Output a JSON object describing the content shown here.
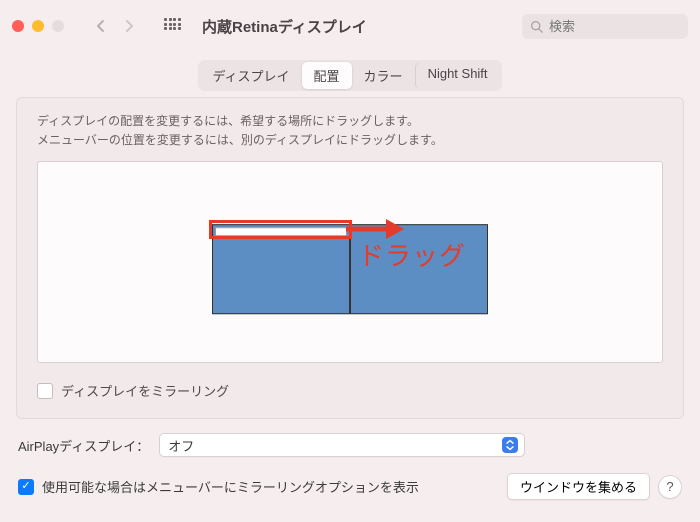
{
  "header": {
    "title": "内蔵Retinaディスプレイ",
    "search_placeholder": "検索"
  },
  "tabs": {
    "display": "ディスプレイ",
    "arrangement": "配置",
    "color": "カラー",
    "night_shift": "Night Shift"
  },
  "panel": {
    "instruction_line1": "ディスプレイの配置を変更するには、希望する場所にドラッグします。",
    "instruction_line2": "メニューバーの位置を変更するには、別のディスプレイにドラッグします。",
    "mirror_label": "ディスプレイをミラーリング",
    "mirror_checked": false
  },
  "annotation": {
    "label": "ドラッグ"
  },
  "airplay": {
    "label": "AirPlayディスプレイ：",
    "value": "オフ"
  },
  "footer": {
    "menubar_option_checked": true,
    "menubar_option_label": "使用可能な場合はメニューバーにミラーリングオプションを表示",
    "gather_button": "ウインドウを集める",
    "help": "?"
  }
}
